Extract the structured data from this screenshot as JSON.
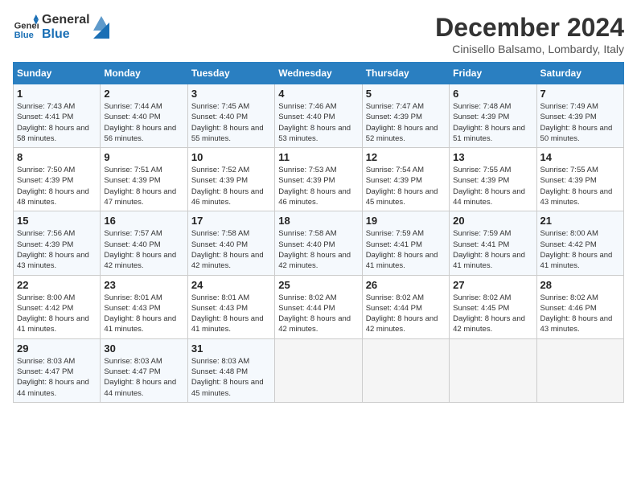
{
  "header": {
    "logo_line1": "General",
    "logo_line2": "Blue",
    "month_title": "December 2024",
    "location": "Cinisello Balsamo, Lombardy, Italy"
  },
  "days_of_week": [
    "Sunday",
    "Monday",
    "Tuesday",
    "Wednesday",
    "Thursday",
    "Friday",
    "Saturday"
  ],
  "weeks": [
    [
      {
        "day": "1",
        "sunrise": "7:43 AM",
        "sunset": "4:41 PM",
        "daylight": "8 hours and 58 minutes."
      },
      {
        "day": "2",
        "sunrise": "7:44 AM",
        "sunset": "4:40 PM",
        "daylight": "8 hours and 56 minutes."
      },
      {
        "day": "3",
        "sunrise": "7:45 AM",
        "sunset": "4:40 PM",
        "daylight": "8 hours and 55 minutes."
      },
      {
        "day": "4",
        "sunrise": "7:46 AM",
        "sunset": "4:40 PM",
        "daylight": "8 hours and 53 minutes."
      },
      {
        "day": "5",
        "sunrise": "7:47 AM",
        "sunset": "4:39 PM",
        "daylight": "8 hours and 52 minutes."
      },
      {
        "day": "6",
        "sunrise": "7:48 AM",
        "sunset": "4:39 PM",
        "daylight": "8 hours and 51 minutes."
      },
      {
        "day": "7",
        "sunrise": "7:49 AM",
        "sunset": "4:39 PM",
        "daylight": "8 hours and 50 minutes."
      }
    ],
    [
      {
        "day": "8",
        "sunrise": "7:50 AM",
        "sunset": "4:39 PM",
        "daylight": "8 hours and 48 minutes."
      },
      {
        "day": "9",
        "sunrise": "7:51 AM",
        "sunset": "4:39 PM",
        "daylight": "8 hours and 47 minutes."
      },
      {
        "day": "10",
        "sunrise": "7:52 AM",
        "sunset": "4:39 PM",
        "daylight": "8 hours and 46 minutes."
      },
      {
        "day": "11",
        "sunrise": "7:53 AM",
        "sunset": "4:39 PM",
        "daylight": "8 hours and 46 minutes."
      },
      {
        "day": "12",
        "sunrise": "7:54 AM",
        "sunset": "4:39 PM",
        "daylight": "8 hours and 45 minutes."
      },
      {
        "day": "13",
        "sunrise": "7:55 AM",
        "sunset": "4:39 PM",
        "daylight": "8 hours and 44 minutes."
      },
      {
        "day": "14",
        "sunrise": "7:55 AM",
        "sunset": "4:39 PM",
        "daylight": "8 hours and 43 minutes."
      }
    ],
    [
      {
        "day": "15",
        "sunrise": "7:56 AM",
        "sunset": "4:39 PM",
        "daylight": "8 hours and 43 minutes."
      },
      {
        "day": "16",
        "sunrise": "7:57 AM",
        "sunset": "4:40 PM",
        "daylight": "8 hours and 42 minutes."
      },
      {
        "day": "17",
        "sunrise": "7:58 AM",
        "sunset": "4:40 PM",
        "daylight": "8 hours and 42 minutes."
      },
      {
        "day": "18",
        "sunrise": "7:58 AM",
        "sunset": "4:40 PM",
        "daylight": "8 hours and 42 minutes."
      },
      {
        "day": "19",
        "sunrise": "7:59 AM",
        "sunset": "4:41 PM",
        "daylight": "8 hours and 41 minutes."
      },
      {
        "day": "20",
        "sunrise": "7:59 AM",
        "sunset": "4:41 PM",
        "daylight": "8 hours and 41 minutes."
      },
      {
        "day": "21",
        "sunrise": "8:00 AM",
        "sunset": "4:42 PM",
        "daylight": "8 hours and 41 minutes."
      }
    ],
    [
      {
        "day": "22",
        "sunrise": "8:00 AM",
        "sunset": "4:42 PM",
        "daylight": "8 hours and 41 minutes."
      },
      {
        "day": "23",
        "sunrise": "8:01 AM",
        "sunset": "4:43 PM",
        "daylight": "8 hours and 41 minutes."
      },
      {
        "day": "24",
        "sunrise": "8:01 AM",
        "sunset": "4:43 PM",
        "daylight": "8 hours and 41 minutes."
      },
      {
        "day": "25",
        "sunrise": "8:02 AM",
        "sunset": "4:44 PM",
        "daylight": "8 hours and 42 minutes."
      },
      {
        "day": "26",
        "sunrise": "8:02 AM",
        "sunset": "4:44 PM",
        "daylight": "8 hours and 42 minutes."
      },
      {
        "day": "27",
        "sunrise": "8:02 AM",
        "sunset": "4:45 PM",
        "daylight": "8 hours and 42 minutes."
      },
      {
        "day": "28",
        "sunrise": "8:02 AM",
        "sunset": "4:46 PM",
        "daylight": "8 hours and 43 minutes."
      }
    ],
    [
      {
        "day": "29",
        "sunrise": "8:03 AM",
        "sunset": "4:47 PM",
        "daylight": "8 hours and 44 minutes."
      },
      {
        "day": "30",
        "sunrise": "8:03 AM",
        "sunset": "4:47 PM",
        "daylight": "8 hours and 44 minutes."
      },
      {
        "day": "31",
        "sunrise": "8:03 AM",
        "sunset": "4:48 PM",
        "daylight": "8 hours and 45 minutes."
      },
      null,
      null,
      null,
      null
    ]
  ],
  "labels": {
    "sunrise": "Sunrise:",
    "sunset": "Sunset:",
    "daylight": "Daylight:"
  }
}
